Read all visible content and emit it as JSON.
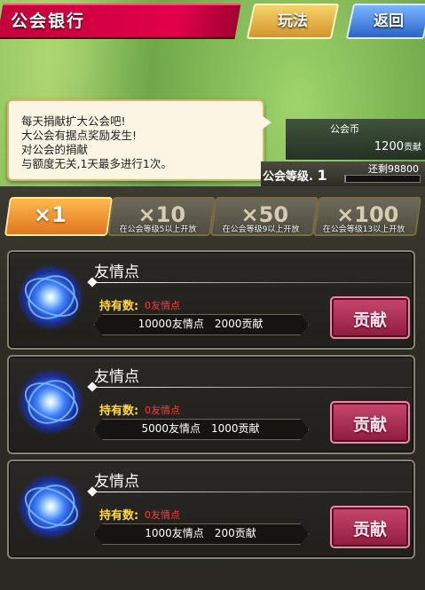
{
  "header": {
    "title": "公会银行",
    "rules_label": "玩法",
    "back_label": "返回"
  },
  "notice": {
    "lines": [
      "每天捐献扩大公会吧!",
      "大公会有据点奖励发生!",
      "对公会的捐献",
      "与额度无关,1天最多进行1次。"
    ]
  },
  "guild": {
    "coin_label": "公会币",
    "coin_value": "1200",
    "coin_unit": "贡献",
    "level_label": "公会等级.",
    "level_value": "1",
    "remaining_label": "还剩",
    "remaining_value": "98800",
    "progress_fraction": 0.012
  },
  "multipliers": [
    {
      "label": "×1",
      "note": "",
      "active": true
    },
    {
      "label": "×10",
      "note": "在公会等级5以上开放",
      "active": false
    },
    {
      "label": "×50",
      "note": "在公会等级9以上开放",
      "active": false
    },
    {
      "label": "×100",
      "note": "在公会等级13以上开放",
      "active": false
    }
  ],
  "items": [
    {
      "name": "友情点",
      "own_label": "持有数:",
      "own_value": "0友情点",
      "exchange": "10000友情点　2000贡献",
      "button": "贡献"
    },
    {
      "name": "友情点",
      "own_label": "持有数:",
      "own_value": "0友情点",
      "exchange": "5000友情点　1000贡献",
      "button": "贡献"
    },
    {
      "name": "友情点",
      "own_label": "持有数:",
      "own_value": "0友情点",
      "exchange": "1000友情点　200贡献",
      "button": "贡献"
    }
  ],
  "colors": {
    "title_bar": "#e1004a",
    "rules_button": "#e0a83c",
    "back_button": "#3c78dc",
    "donate_button": "#b03357",
    "own_value": "#ff3a3a",
    "own_label": "#ffd94a"
  }
}
